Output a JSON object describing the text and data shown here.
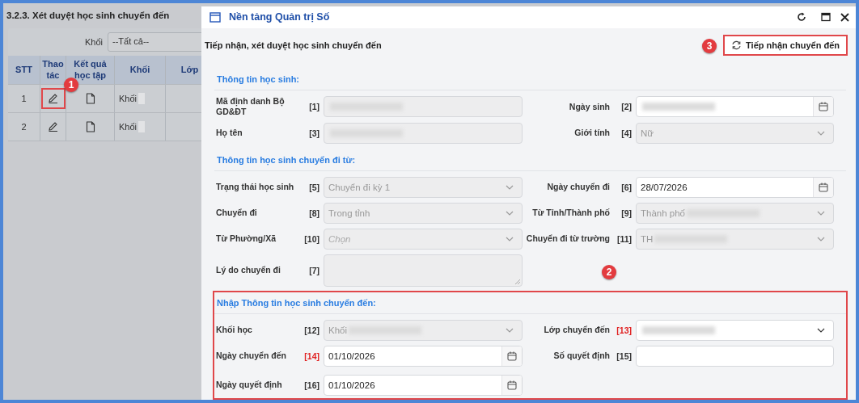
{
  "page": {
    "title": "3.2.3. Xét duyệt học sinh chuyển đến",
    "filter": {
      "label": "Khối",
      "value": "--Tất cả--"
    },
    "table": {
      "columns": [
        "STT",
        "Thao tác",
        "Kết quả học tập",
        "Khối",
        "Lớp"
      ],
      "rows": [
        {
          "stt": "1",
          "khoi": "Khối",
          "highlighted": true,
          "badge": "1"
        },
        {
          "stt": "2",
          "khoi": "Khối",
          "highlighted": false
        }
      ]
    }
  },
  "dialog": {
    "title": "Nền tảng Quản trị Số",
    "subtitle": "Tiếp nhận, xét duyệt học sinh chuyển đến",
    "action": {
      "label": "Tiếp nhận chuyển đến",
      "highlighted": true,
      "badge": "3"
    },
    "sections": [
      {
        "title": "Thông tin học sinh:",
        "highlighted": false,
        "rows": [
          [
            {
              "label": "Mã định danh Bộ GD&ĐT",
              "tag": "[1]",
              "required": false,
              "kind": "text",
              "disabled": true,
              "redacted": true
            },
            {
              "label": "Ngày sinh",
              "tag": "[2]",
              "required": false,
              "kind": "date",
              "disabled": false,
              "redacted": true
            }
          ],
          [
            {
              "label": "Họ tên",
              "tag": "[3]",
              "required": false,
              "kind": "text",
              "disabled": true,
              "redacted": true
            },
            {
              "label": "Giới tính",
              "tag": "[4]",
              "required": false,
              "kind": "select",
              "disabled": true,
              "redacted": false,
              "value": "Nữ"
            }
          ]
        ]
      },
      {
        "title": "Thông tin học sinh chuyển đi từ:",
        "highlighted": false,
        "rows": [
          [
            {
              "label": "Trạng thái học sinh",
              "tag": "[5]",
              "required": false,
              "kind": "select",
              "disabled": true,
              "redacted": false,
              "value": "Chuyển đi kỳ 1"
            },
            {
              "label": "Ngày chuyển đi",
              "tag": "[6]",
              "required": false,
              "kind": "date",
              "disabled": false,
              "redacted": false,
              "value": "28/07/2026"
            }
          ],
          [
            {
              "label": "Chuyển đi",
              "tag": "[8]",
              "required": false,
              "kind": "select",
              "disabled": true,
              "redacted": false,
              "value": "Trong tỉnh"
            },
            {
              "label": "Từ Tỉnh/Thành phố",
              "tag": "[9]",
              "required": false,
              "kind": "select",
              "disabled": true,
              "redacted": true,
              "value": "Thành phố"
            }
          ],
          [
            {
              "label": "Từ Phường/Xã",
              "tag": "[10]",
              "required": false,
              "kind": "select",
              "disabled": true,
              "redacted": false,
              "placeholder": "Chọn"
            },
            {
              "label": "Chuyển đi từ trường",
              "tag": "[11]",
              "required": false,
              "kind": "select",
              "disabled": true,
              "redacted": true,
              "value": "TH"
            }
          ],
          [
            {
              "label": "Lý do chuyển đi",
              "tag": "[7]",
              "required": false,
              "kind": "textarea",
              "disabled": true,
              "redacted": false
            }
          ]
        ]
      },
      {
        "title": "Nhập Thông tin học sinh chuyển đến:",
        "highlighted": true,
        "badge": "2",
        "rows": [
          [
            {
              "label": "Khối học",
              "tag": "[12]",
              "required": false,
              "kind": "select",
              "disabled": true,
              "redacted": true,
              "value": "Khối"
            },
            {
              "label": "Lớp chuyển đến",
              "tag": "[13]",
              "required": true,
              "kind": "select",
              "disabled": false,
              "redacted": true
            }
          ],
          [
            {
              "label": "Ngày chuyển đến",
              "tag": "[14]",
              "required": true,
              "kind": "date",
              "disabled": false,
              "redacted": false,
              "value": "01/10/2026"
            },
            {
              "label": "Số quyết định",
              "tag": "[15]",
              "required": false,
              "kind": "text",
              "disabled": false,
              "redacted": false
            }
          ],
          [
            {
              "label": "Ngày quyết định",
              "tag": "[16]",
              "required": false,
              "kind": "date",
              "disabled": false,
              "redacted": false,
              "value": "01/10/2026"
            }
          ]
        ]
      }
    ]
  }
}
